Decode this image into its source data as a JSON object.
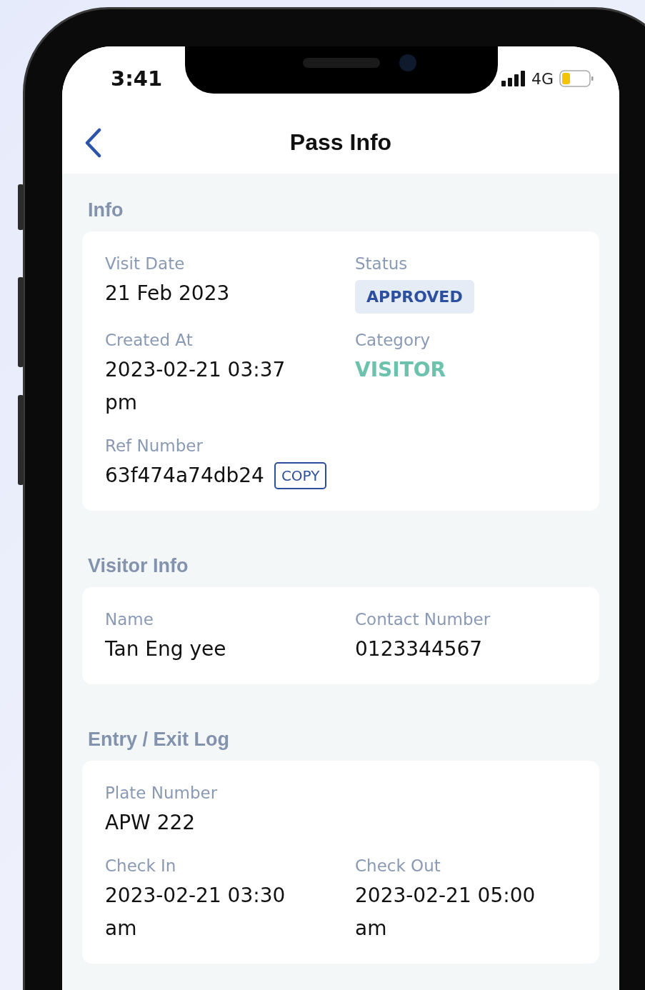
{
  "status_bar": {
    "time": "3:41",
    "network": "4G"
  },
  "header": {
    "title": "Pass Info"
  },
  "sections": [
    {
      "title": "Info",
      "fields": [
        {
          "label": "Visit Date",
          "value": "21 Feb 2023",
          "kind": "text"
        },
        {
          "label": "Status",
          "value": "APPROVED",
          "kind": "badge"
        },
        {
          "label": "Created At",
          "value": "2023-02-21 03:37 pm",
          "kind": "text"
        },
        {
          "label": "Category",
          "value": "VISITOR",
          "kind": "accent"
        },
        {
          "label": "Ref Number",
          "value": "63f474a74db24",
          "kind": "copy",
          "action": "COPY"
        }
      ]
    },
    {
      "title": "Visitor Info",
      "fields": [
        {
          "label": "Name",
          "value": "Tan Eng yee",
          "kind": "text"
        },
        {
          "label": "Contact Number",
          "value": "0123344567",
          "kind": "text"
        }
      ]
    },
    {
      "title": "Entry / Exit Log",
      "fields": [
        {
          "label": "Plate Number",
          "value": "APW 222",
          "kind": "wide"
        },
        {
          "label": "Check In",
          "value": "2023-02-21 03:30 am",
          "kind": "text"
        },
        {
          "label": "Check Out",
          "value": "2023-02-21 05:00 am",
          "kind": "text"
        }
      ]
    }
  ]
}
